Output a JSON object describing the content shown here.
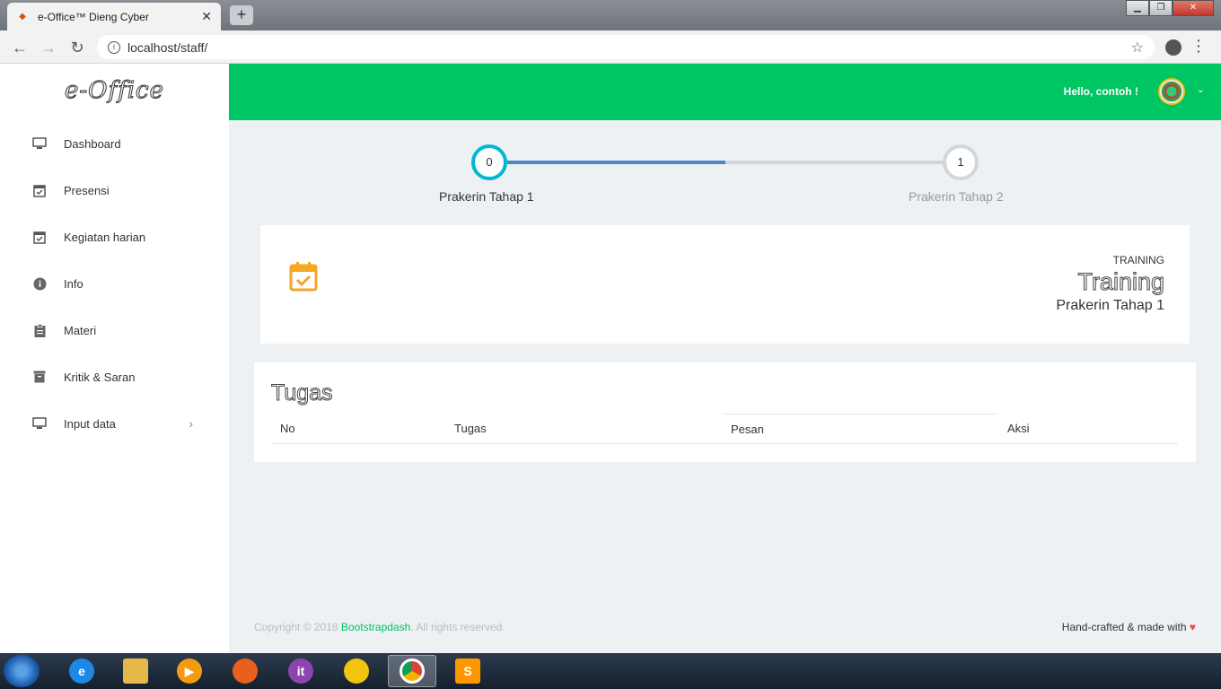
{
  "browser": {
    "tab_title": "e-Office™ Dieng Cyber",
    "tab_close": "✕",
    "new_tab": "+",
    "url": "localhost/staff/",
    "window_controls": [
      "▁",
      "❐",
      "✕"
    ]
  },
  "sidebar": {
    "brand": "e-Office",
    "items": [
      {
        "label": "Dashboard",
        "icon": "monitor-icon"
      },
      {
        "label": "Presensi",
        "icon": "calendar-check-icon"
      },
      {
        "label": "Kegiatan harian",
        "icon": "calendar-check-icon"
      },
      {
        "label": "Info",
        "icon": "info-icon"
      },
      {
        "label": "Materi",
        "icon": "clipboard-icon"
      },
      {
        "label": "Kritik & Saran",
        "icon": "archive-icon"
      },
      {
        "label": "Input data",
        "icon": "monitor-icon",
        "chevron": "›"
      }
    ]
  },
  "header": {
    "greeting": "Hello, contoh !",
    "avatar_chevron": "⌄"
  },
  "stepper": {
    "progress": 0.5,
    "steps": [
      {
        "number": "0",
        "label": "Prakerin Tahap 1"
      },
      {
        "number": "1",
        "label": "Prakerin Tahap 2"
      }
    ]
  },
  "training_card": {
    "small": "TRAINING",
    "big": "Training",
    "sub": "Prakerin Tahap 1"
  },
  "tugas": {
    "title": "Tugas",
    "columns": [
      "No",
      "Tugas",
      "Pesan",
      "Aksi"
    ]
  },
  "footer": {
    "copyright_prefix": "Copyright © 2018 ",
    "link": "Bootstrapdash",
    "copyright_suffix": ". All rights reserved.",
    "right_text": "Hand-crafted & made with ",
    "heart": "♥"
  },
  "colors": {
    "brand_green": "#00c563",
    "step_active": "#00b8d4",
    "progress": "#4a89c8",
    "calendar_icon": "#f5a623"
  }
}
